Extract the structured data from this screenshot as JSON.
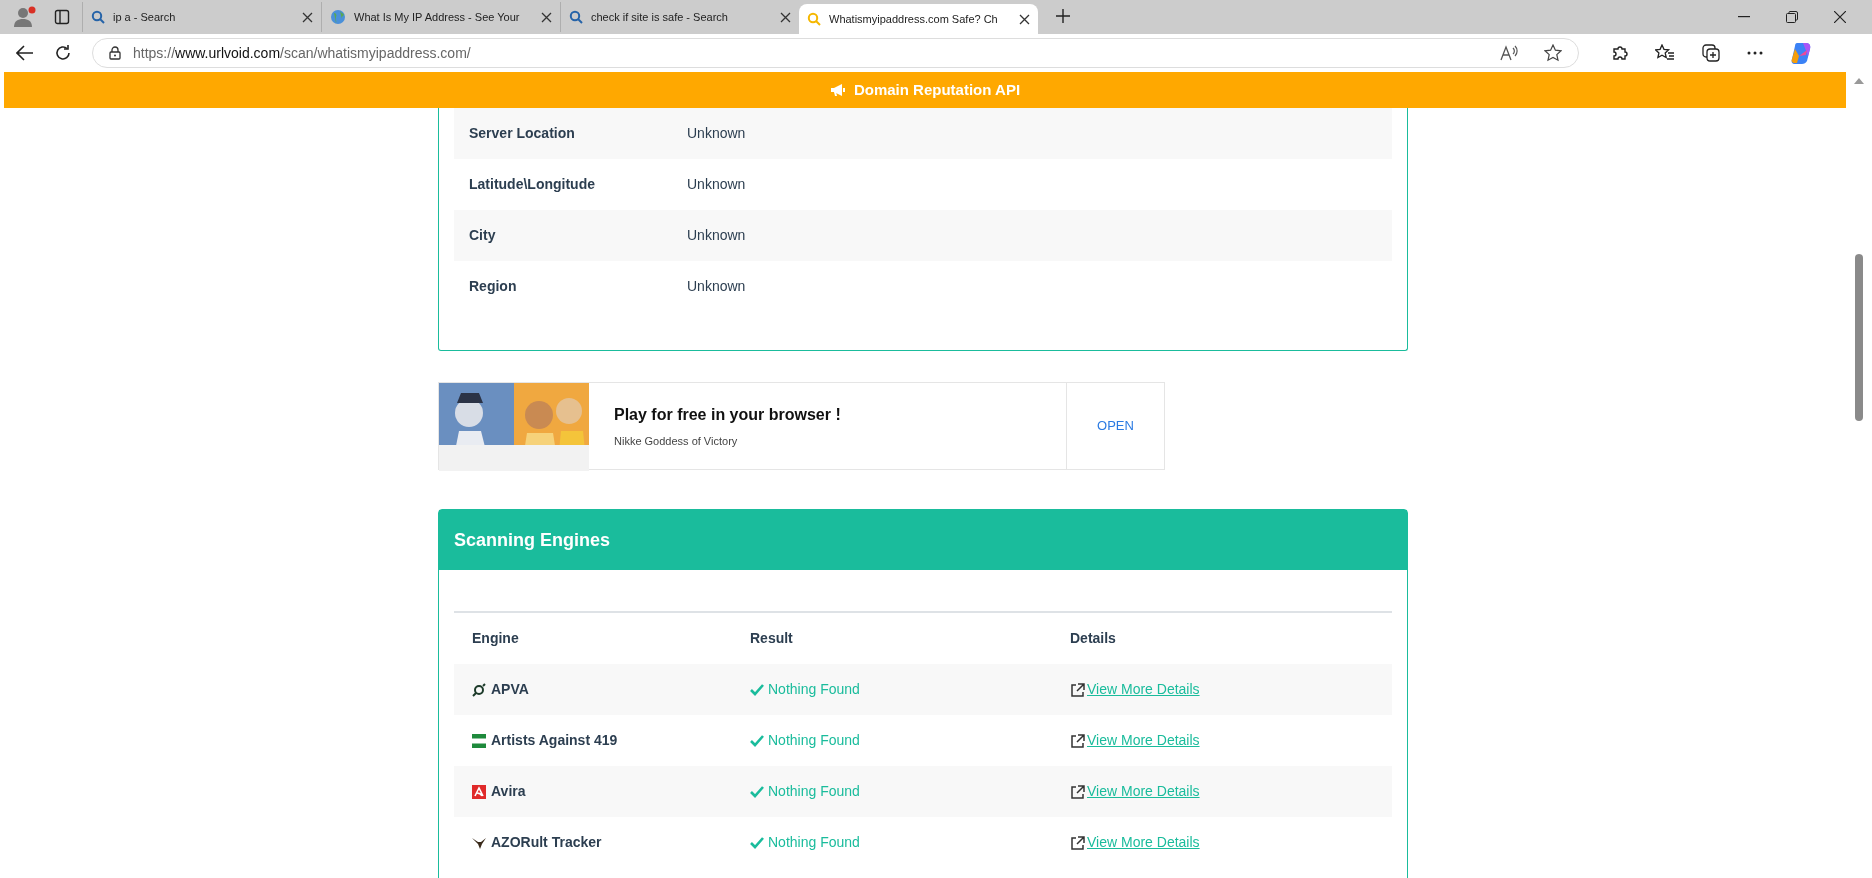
{
  "browser": {
    "tabs": [
      {
        "title": "ip a - Search",
        "kind": "search",
        "selected": false
      },
      {
        "title": "What Is My IP Address - See Your",
        "kind": "globe",
        "selected": false
      },
      {
        "title": "check if site is safe - Search",
        "kind": "search",
        "selected": false
      },
      {
        "title": "Whatismyipaddress.com Safe? Ch",
        "kind": "search",
        "selected": true
      }
    ],
    "address": "https://**www.urlvoid.com**/scan/whatismyipaddress.com/"
  },
  "banner": {
    "label": "Domain Reputation API"
  },
  "location_table": {
    "rows": [
      {
        "label": "Server Location",
        "value": "Unknown"
      },
      {
        "label": "Latitude\\Longitude",
        "value": "Unknown"
      },
      {
        "label": "City",
        "value": "Unknown"
      },
      {
        "label": "Region",
        "value": "Unknown"
      }
    ]
  },
  "ad": {
    "kind": "picture",
    "title": "Play for free in your browser !",
    "subtitle": "Nikke Goddess of Victory",
    "button": "OPEN"
  },
  "scanning_engines": {
    "title": "Scanning Engines",
    "columns": [
      "Engine",
      "Result",
      "Details"
    ],
    "rows": [
      {
        "engine": "APVA",
        "kind": "apva",
        "result": "Nothing Found",
        "details": "View More Details"
      },
      {
        "engine": "Artists Against 419",
        "kind": "flag",
        "result": "Nothing Found",
        "details": "View More Details"
      },
      {
        "engine": "Avira",
        "kind": "avira",
        "result": "Nothing Found",
        "details": "View More Details"
      },
      {
        "engine": "AZORult Tracker",
        "kind": "bird",
        "result": "Nothing Found",
        "details": "View More Details"
      }
    ]
  }
}
